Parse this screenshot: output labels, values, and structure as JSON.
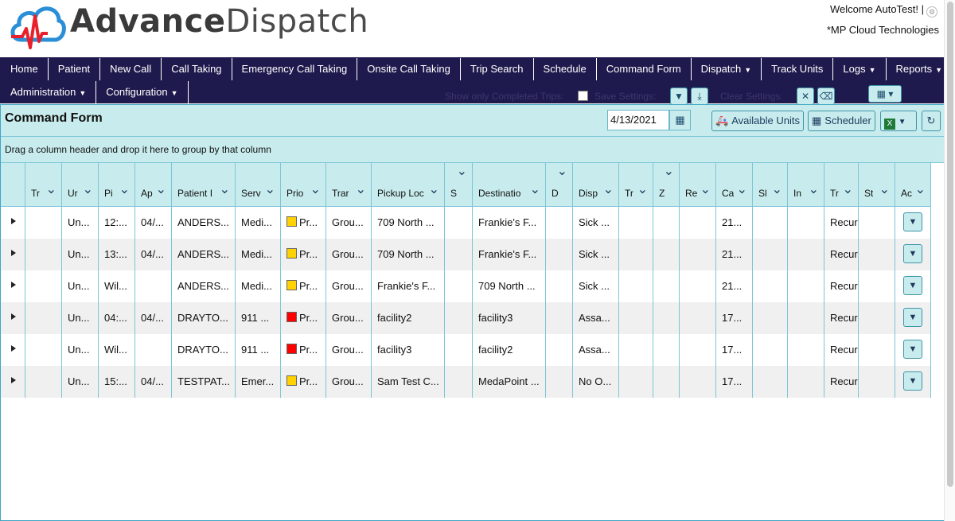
{
  "brand": {
    "part1": "Advance",
    "part2": "Dispatch"
  },
  "header": {
    "welcome": "Welcome AutoTest! |",
    "company": "*MP Cloud Technologies"
  },
  "nav": {
    "row1": [
      "Home",
      "Patient",
      "New Call",
      "Call Taking",
      "Emergency Call Taking",
      "Onsite Call Taking",
      "Trip Search",
      "Schedule",
      "Command Form",
      "Dispatch",
      "Track Units",
      "Logs",
      "Reports"
    ],
    "row2": [
      "Administration",
      "Configuration"
    ],
    "show_completed_label": "Show only Completed Trips:",
    "save_settings_label": "Save Settings:",
    "clear_settings_label": "Clear Settings:"
  },
  "page": {
    "title": "Command Form",
    "date": "4/13/2021",
    "available_units": "Available Units",
    "scheduler": "Scheduler",
    "group_hint": "Drag a column header and drop it here to group by that column"
  },
  "columns": [
    "Tr",
    "Ur",
    "Pi",
    "Ap",
    "Patient I",
    "Serv",
    "Prio",
    "Trar",
    "Pickup Loc",
    "S",
    "Destinatio",
    "D",
    "Disp",
    "Tr",
    "Z",
    "Re",
    "Ca",
    "Sl",
    "In",
    "Tr",
    "St",
    "Ac"
  ],
  "rows": [
    {
      "c": [
        "",
        "Un...",
        "12:...",
        "04/...",
        "ANDERS...",
        "Medi...",
        "Pr...",
        "Grou...",
        "709 North ...",
        "",
        "Frankie's F...",
        "",
        "Sick ...",
        "",
        "",
        "",
        "21...",
        "",
        "",
        "Recurr",
        "",
        ""
      ],
      "prio_color": "#ffd200"
    },
    {
      "c": [
        "",
        "Un...",
        "13:...",
        "04/...",
        "ANDERS...",
        "Medi...",
        "Pr...",
        "Grou...",
        "709 North ...",
        "",
        "Frankie's F...",
        "",
        "Sick ...",
        "",
        "",
        "",
        "21...",
        "",
        "",
        "Recurr",
        "",
        ""
      ],
      "prio_color": "#ffd200"
    },
    {
      "c": [
        "",
        "Un...",
        "Wil...",
        "",
        "ANDERS...",
        "Medi...",
        "Pr...",
        "Grou...",
        "Frankie's F...",
        "",
        "709 North ...",
        "",
        "Sick ...",
        "",
        "",
        "",
        "21...",
        "",
        "",
        "Recurr",
        "",
        ""
      ],
      "prio_color": "#ffd200"
    },
    {
      "c": [
        "",
        "Un...",
        "04:...",
        "04/...",
        "DRAYTO...",
        "911 ...",
        "Pr...",
        "Grou...",
        "facility2",
        "",
        "facility3",
        "",
        "Assa...",
        "",
        "",
        "",
        "17...",
        "",
        "",
        "Recurr",
        "",
        ""
      ],
      "prio_color": "#ff0000"
    },
    {
      "c": [
        "",
        "Un...",
        "Wil...",
        "",
        "DRAYTO...",
        "911 ...",
        "Pr...",
        "Grou...",
        "facility3",
        "",
        "facility2",
        "",
        "Assa...",
        "",
        "",
        "",
        "17...",
        "",
        "",
        "Recurr",
        "",
        ""
      ],
      "prio_color": "#ff0000"
    },
    {
      "c": [
        "",
        "Un...",
        "15:...",
        "04/...",
        "TESTPAT...",
        "Emer...",
        "Pr...",
        "Grou...",
        "Sam Test C...",
        "",
        "MedaPoint ...",
        "",
        "No O...",
        "",
        "",
        "",
        "17...",
        "",
        "",
        "Recurr",
        "",
        ""
      ],
      "prio_color": "#ffd200"
    }
  ],
  "colors": {
    "nav_bg": "#1f1a4d",
    "panel_bg": "#c8eced",
    "border": "#3ea6c4",
    "logo_red": "#e8202b",
    "logo_blue": "#2a8fd6"
  }
}
